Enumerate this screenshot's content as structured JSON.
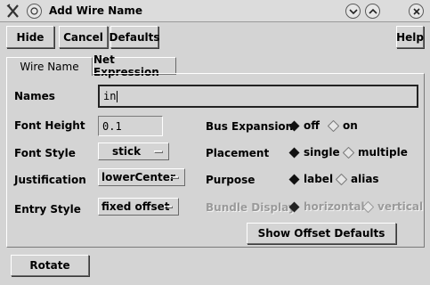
{
  "window": {
    "title": "Add Wire Name"
  },
  "toolbar": {
    "hide": "Hide",
    "cancel": "Cancel",
    "defaults": "Defaults",
    "help": "Help"
  },
  "tabs": [
    {
      "label": "Wire Name",
      "active": true
    },
    {
      "label": "Net Expression",
      "active": false
    }
  ],
  "form": {
    "names": {
      "label": "Names",
      "value": "in"
    },
    "font_height": {
      "label": "Font Height",
      "value": "0.1"
    },
    "font_style": {
      "label": "Font Style",
      "value": "stick"
    },
    "justification": {
      "label": "Justification",
      "value": "lowerCenter"
    },
    "entry_style": {
      "label": "Entry Style",
      "value": "fixed offset"
    },
    "bus_expansion": {
      "label": "Bus Expansion",
      "options": [
        "off",
        "on"
      ],
      "selected": "off"
    },
    "placement": {
      "label": "Placement",
      "options": [
        "single",
        "multiple"
      ],
      "selected": "single"
    },
    "purpose": {
      "label": "Purpose",
      "options": [
        "label",
        "alias"
      ],
      "selected": "label"
    },
    "bundle_display": {
      "label": "Bundle Display",
      "options": [
        "horizontal",
        "vertical"
      ],
      "selected": "horizontal",
      "enabled": false
    },
    "show_offset_defaults": "Show Offset Defaults"
  },
  "footer": {
    "rotate": "Rotate"
  }
}
